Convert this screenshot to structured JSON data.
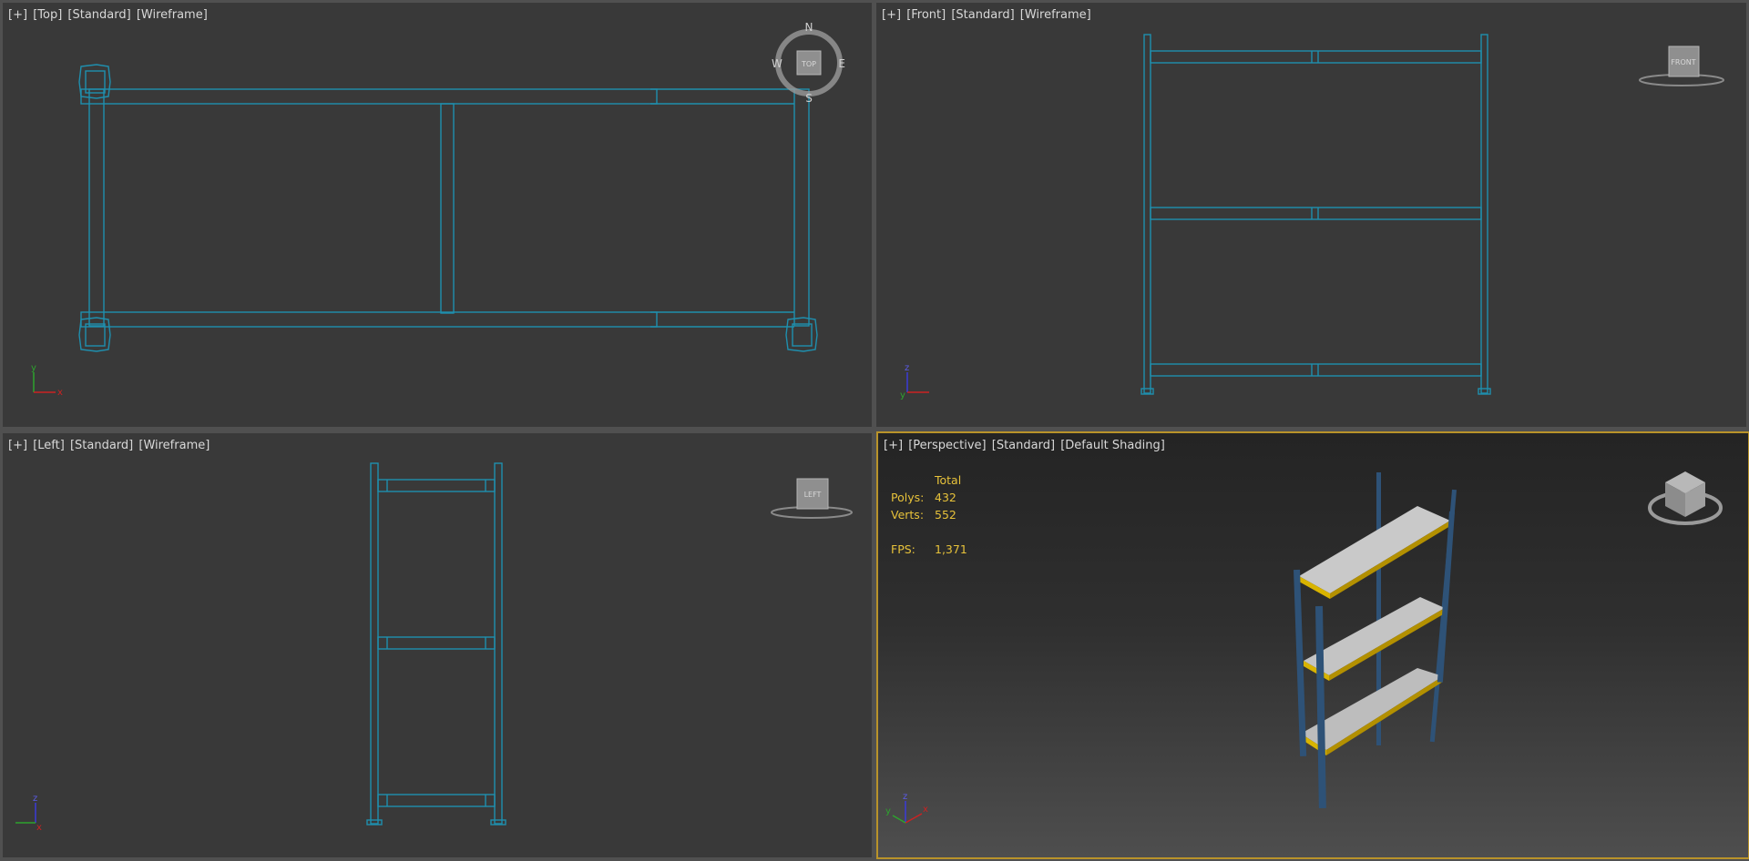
{
  "viewports": {
    "top": {
      "menu": "[+]",
      "view": "[Top]",
      "shading_set": "[Standard]",
      "mode": "[Wireframe]",
      "cube_face": "TOP",
      "compass": {
        "n": "N",
        "s": "S",
        "e": "E",
        "w": "W"
      },
      "axes": {
        "vertical": "y",
        "horizontal": "x"
      }
    },
    "front": {
      "menu": "[+]",
      "view": "[Front]",
      "shading_set": "[Standard]",
      "mode": "[Wireframe]",
      "cube_face": "FRONT",
      "axes": {
        "vertical": "z",
        "horizontal": "y"
      }
    },
    "left": {
      "menu": "[+]",
      "view": "[Left]",
      "shading_set": "[Standard]",
      "mode": "[Wireframe]",
      "cube_face": "LEFT",
      "axes": {
        "vertical": "z",
        "horizontal": "x"
      }
    },
    "perspective": {
      "menu": "[+]",
      "view": "[Perspective]",
      "shading_set": "[Standard]",
      "mode": "[Default Shading]",
      "axes": {
        "vertical": "z",
        "horizontal": "x",
        "depth": "y"
      }
    }
  },
  "stats": {
    "header": "Total",
    "polys_label": "Polys:",
    "polys_value": "432",
    "verts_label": "Verts:",
    "verts_value": "552",
    "fps_label": "FPS:",
    "fps_value": "1,371"
  },
  "colors": {
    "wire": "#1f8fae",
    "active_border": "#b9932a",
    "stats": "#e7c23a",
    "shelf_top": "#c9c9c9",
    "shelf_edge": "#d9b400",
    "leg": "#2e5277"
  }
}
